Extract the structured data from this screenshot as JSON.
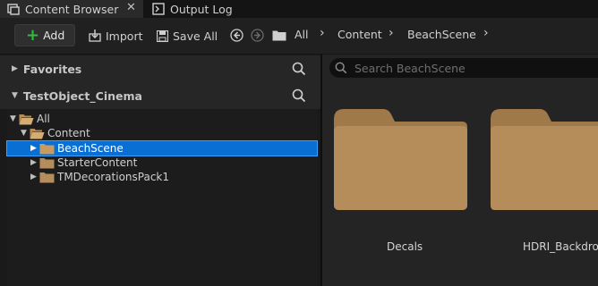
{
  "tabs": [
    {
      "label": "Content Browser",
      "icon": "content-browser-icon",
      "active": true,
      "close": "✕"
    },
    {
      "label": "Output Log",
      "icon": "output-log-icon",
      "active": false
    }
  ],
  "toolbar": {
    "add_label": "Add",
    "import_label": "Import",
    "save_all_label": "Save All",
    "breadcrumb": [
      "All",
      "Content",
      "BeachScene"
    ]
  },
  "sidebar": {
    "favorites_label": "Favorites",
    "project_label": "TestObject_Cinema",
    "tree": [
      {
        "label": "All",
        "depth": 0,
        "expanded": true
      },
      {
        "label": "Content",
        "depth": 1,
        "expanded": true
      },
      {
        "label": "BeachScene",
        "depth": 2,
        "selected": true
      },
      {
        "label": "StarterContent",
        "depth": 2
      },
      {
        "label": "TMDecorationsPack1",
        "depth": 2
      }
    ]
  },
  "content": {
    "search_placeholder": "Search BeachScene",
    "folders": [
      "Decals",
      "HDRI_Backdrop"
    ]
  },
  "colors": {
    "selection": "#0a6fd4",
    "folder": "#b48d5a",
    "add_plus": "#2fbf3c"
  }
}
